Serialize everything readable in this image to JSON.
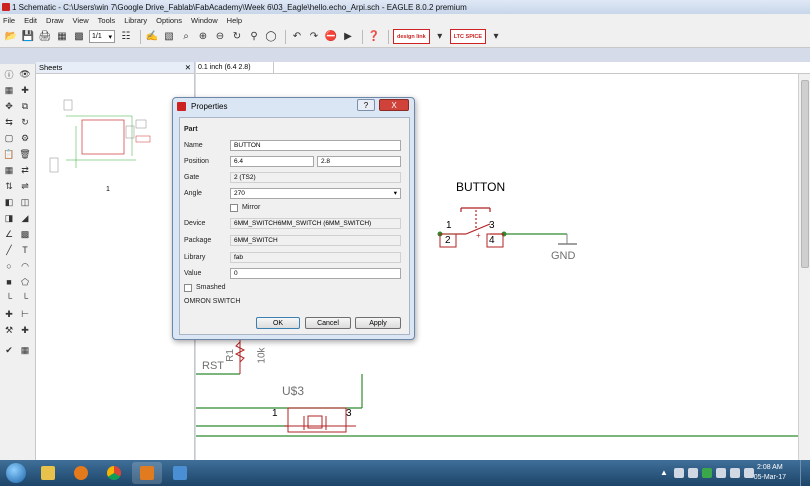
{
  "window": {
    "title": "1 Schematic - C:\\Users\\win 7\\Google Drive_Fablab\\FabAcademy\\Week 6\\03_Eagle\\hello.echo_Arpi.sch - EAGLE 8.0.2 premium"
  },
  "menu": [
    "File",
    "Edit",
    "Draw",
    "View",
    "Tools",
    "Library",
    "Options",
    "Window",
    "Help"
  ],
  "toolbar": {
    "sheet_select": "1/1",
    "design_link_logo": "design link",
    "spice_logo": "LTC SPICE"
  },
  "sheets_panel": {
    "title": "Sheets",
    "sheet_number": "1"
  },
  "command_line": {
    "coordinate": "0.1 inch (6.4 2.8)"
  },
  "schematic": {
    "button_label": "BUTTON",
    "pin1": "1",
    "pin2": "2",
    "pin3": "3",
    "pin4": "4",
    "gnd_label": "GND",
    "rst_label": "RST",
    "r1_label": "R1",
    "r_value": "10k",
    "us3_label": "U$3",
    "us3_pin1": "1",
    "us3_pin3": "3"
  },
  "dialog": {
    "title": "Properties",
    "help_btn": "?",
    "close_btn": "X",
    "section": "Part",
    "name_label": "Name",
    "name_value": "BUTTON",
    "position_label": "Position",
    "position_x": "6.4",
    "position_y": "2.8",
    "gate_label": "Gate",
    "gate_value": "2 (TS2)",
    "angle_label": "Angle",
    "angle_value": "270",
    "mirror_label": "Mirror",
    "device_label": "Device",
    "device_value": "6MM_SWITCH6MM_SWITCH (6MM_SWITCH)",
    "package_label": "Package",
    "package_value": "6MM_SWITCH",
    "library_label": "Library",
    "library_value": "fab",
    "value_label": "Value",
    "value_value": "0",
    "smashed_label": "Smashed",
    "description": "OMRON SWITCH",
    "ok": "OK",
    "cancel": "Cancel",
    "apply": "Apply"
  },
  "taskbar": {
    "time": "2:08 AM",
    "date": "05-Mar-17"
  },
  "colors": {
    "net_wire": "#2e8b2e",
    "part_symbol": "#b22222",
    "label_gray": "#707070"
  }
}
